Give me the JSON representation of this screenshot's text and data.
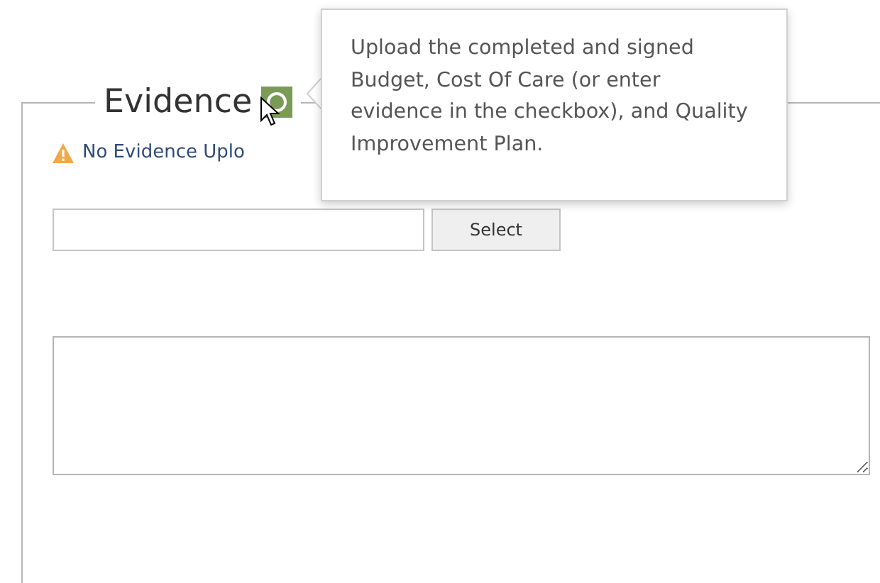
{
  "section": {
    "title": "Evidence"
  },
  "tooltip": {
    "text": "Upload the completed and signed Budget, Cost Of Care (or enter evidence in the checkbox), and Quality Improvement Plan."
  },
  "warning": {
    "text": "No Evidence Uplo"
  },
  "file_upload": {
    "button": "Select"
  }
}
